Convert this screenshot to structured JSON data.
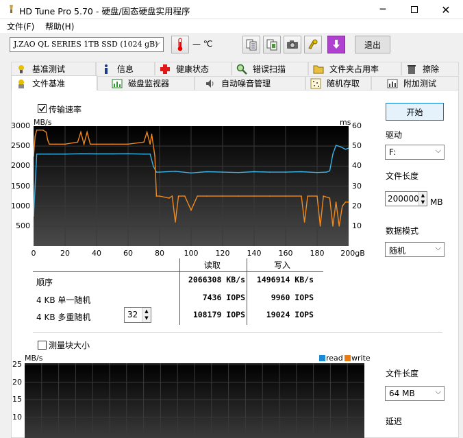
{
  "window": {
    "title": "HD Tune Pro 5.70 - 硬盘/固态硬盘实用程序"
  },
  "menu": [
    {
      "label": "文件(F)"
    },
    {
      "label": "帮助(H)"
    }
  ],
  "toolbar": {
    "drive": "J.ZAO QL SERIES 1TB SSD (1024 gB)",
    "temperature": "— ℃",
    "exit_label": "退出",
    "icons": [
      "copy-text-icon",
      "copy-screenshot-icon",
      "camera-icon",
      "options-icon",
      "save-icon"
    ]
  },
  "tabs": {
    "row1": [
      {
        "label": "基准测试",
        "icon": "benchmark-icon"
      },
      {
        "label": "信息",
        "icon": "info-icon"
      },
      {
        "label": "健康状态",
        "icon": "health-icon"
      },
      {
        "label": "错误扫描",
        "icon": "error-scan-icon"
      },
      {
        "label": "文件夹占用率",
        "icon": "folder-usage-icon"
      },
      {
        "label": "擦除",
        "icon": "erase-icon"
      }
    ],
    "row2": [
      {
        "label": "文件基准",
        "icon": "file-benchmark-icon",
        "active": true
      },
      {
        "label": "磁盘监视器",
        "icon": "disk-monitor-icon"
      },
      {
        "label": "自动噪音管理",
        "icon": "aam-icon"
      },
      {
        "label": "随机存取",
        "icon": "random-access-icon"
      },
      {
        "label": "附加测试",
        "icon": "extra-tests-icon"
      }
    ]
  },
  "transfer": {
    "checkbox_label": "传输速率",
    "checked": true,
    "y_left_unit": "MB/s",
    "y_right_unit": "ms",
    "y_left_ticks": [
      "3000",
      "2500",
      "2000",
      "1500",
      "1000",
      "500"
    ],
    "y_right_ticks": [
      "60",
      "50",
      "40",
      "30",
      "20",
      "10"
    ],
    "x_ticks": [
      "0",
      "20",
      "40",
      "60",
      "80",
      "100",
      "120",
      "140",
      "160",
      "180",
      "200gB"
    ]
  },
  "results": {
    "col_read": "读取",
    "col_write": "写入",
    "rows": [
      {
        "label": "顺序",
        "read": "2066308 KB/s",
        "write": "1496914 KB/s"
      },
      {
        "label": "4 KB 单一随机",
        "read": "7436 IOPS",
        "write": "9960 IOPS"
      },
      {
        "label": "4 KB 多重随机",
        "read": "108179 IOPS",
        "write": "19024 IOPS"
      }
    ],
    "queue_depth": "32"
  },
  "right_panel": {
    "start_label": "开始",
    "drive_label": "驱动",
    "drive_value": "F:",
    "file_length_label": "文件长度",
    "file_length_value": "200000",
    "file_length_unit": "MB",
    "data_mode_label": "数据模式",
    "data_mode_value": "随机",
    "file_length2_label": "文件长度",
    "file_length2_value": "64 MB",
    "delay_label": "延迟"
  },
  "block": {
    "checkbox_label": "测量块大小",
    "checked": false,
    "y_unit": "MB/s",
    "y_ticks": [
      "25",
      "20",
      "15",
      "10"
    ],
    "legend_read": "read",
    "legend_write": "write"
  },
  "colors": {
    "read_line": "#3cb4e6",
    "write_line": "#f28a1e",
    "read_legend": "#1b8bd6",
    "write_legend": "#e87b14",
    "chart_bg_top": "#000000",
    "chart_bg_bottom": "#4a4a4a"
  },
  "chart_data": [
    {
      "type": "line",
      "title": "",
      "xlabel": "gB",
      "ylabel": "MB/s",
      "y2label": "ms",
      "xlim": [
        0,
        200
      ],
      "ylim": [
        0,
        3000
      ],
      "y2lim": [
        0,
        60
      ],
      "grid": true,
      "series": [
        {
          "axis": "MB/s",
          "x": [
            0,
            1,
            2,
            4,
            10,
            20,
            30,
            40,
            50,
            60,
            70,
            74,
            76,
            78,
            80,
            90,
            100,
            110,
            120,
            130,
            140,
            150,
            160,
            170,
            180,
            186,
            188,
            190,
            192,
            195,
            198,
            200
          ],
          "values": [
            750,
            1500,
            2300,
            2300,
            2300,
            2300,
            2310,
            2305,
            2305,
            2310,
            2300,
            2300,
            2000,
            1850,
            1850,
            1870,
            1830,
            1860,
            1850,
            1840,
            1860,
            1850,
            1850,
            1860,
            1840,
            1850,
            1880,
            2300,
            2520,
            2480,
            2420,
            2450
          ]
        },
        {
          "axis": "ms",
          "x": [
            0,
            1,
            2,
            4,
            6,
            8,
            9,
            10,
            14,
            20,
            28,
            30,
            32,
            34,
            36,
            40,
            50,
            60,
            70,
            72,
            74,
            75,
            77,
            78,
            80,
            86,
            88,
            90,
            92,
            96,
            100,
            104,
            110,
            120,
            130,
            140,
            150,
            160,
            170,
            172,
            174,
            180,
            182,
            184,
            188,
            190,
            192,
            194,
            196,
            198,
            200
          ],
          "values": [
            45,
            55,
            58,
            58,
            58,
            57,
            53,
            51,
            51,
            51,
            52,
            57,
            51,
            57,
            51,
            51,
            51,
            51,
            52,
            57,
            51,
            56,
            45,
            25,
            25,
            24,
            25,
            12,
            25,
            25,
            18,
            25,
            25,
            25,
            25,
            25,
            25,
            25,
            25,
            12,
            25,
            25,
            10,
            25,
            24,
            10,
            22,
            10,
            20,
            22,
            22
          ]
        }
      ]
    },
    {
      "type": "bar",
      "title": "",
      "xlabel": "",
      "ylabel": "MB/s",
      "ylim": [
        5,
        25
      ],
      "series": [
        {
          "name": "read",
          "values": []
        },
        {
          "name": "write",
          "values": []
        }
      ]
    }
  ]
}
